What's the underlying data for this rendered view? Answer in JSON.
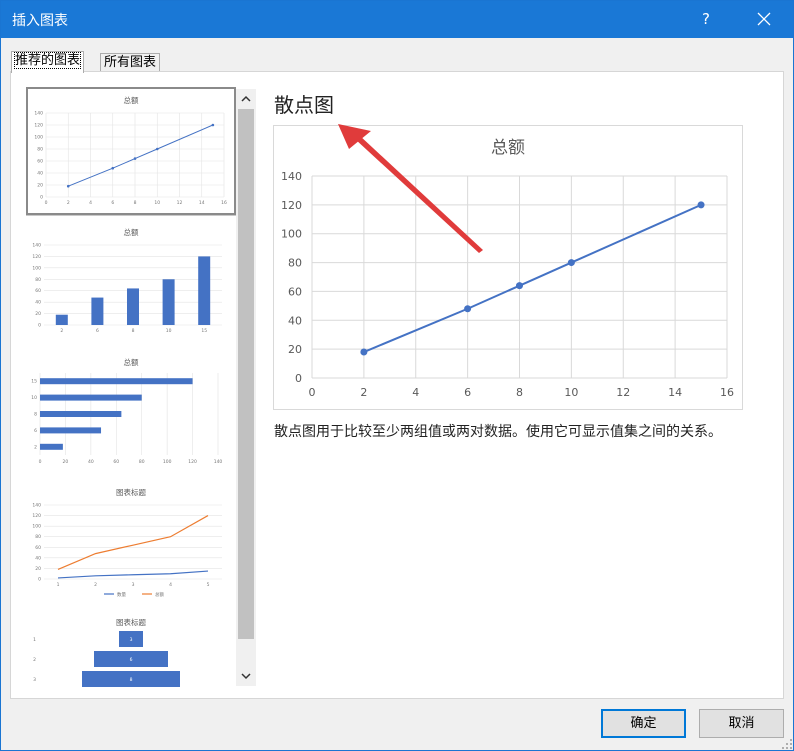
{
  "window": {
    "title": "插入图表",
    "help_label": "?"
  },
  "tabs": [
    {
      "label": "推荐的图表",
      "active": true
    },
    {
      "label": "所有图表",
      "active": false
    }
  ],
  "thumbnails": [
    {
      "title": "总额",
      "type": "scatter",
      "x_ticks": [
        "0",
        "2",
        "4",
        "6",
        "8",
        "10",
        "12",
        "14",
        "16"
      ],
      "y_ticks": [
        "0",
        "20",
        "40",
        "60",
        "80",
        "100",
        "120",
        "140"
      ]
    },
    {
      "title": "总额",
      "type": "bar",
      "x_ticks": [
        "2",
        "6",
        "8",
        "10",
        "15"
      ],
      "y_ticks": [
        "0",
        "20",
        "40",
        "60",
        "80",
        "100",
        "120",
        "140"
      ]
    },
    {
      "title": "总额",
      "type": "barh",
      "x_ticks": [
        "0",
        "20",
        "40",
        "60",
        "80",
        "100",
        "120",
        "140"
      ],
      "y_ticks": [
        "2",
        "6",
        "8",
        "10",
        "15"
      ]
    },
    {
      "title": "图表标题",
      "type": "line",
      "x_ticks": [
        "1",
        "2",
        "3",
        "4",
        "5"
      ],
      "y_ticks": [
        "0",
        "20",
        "40",
        "60",
        "80",
        "100",
        "120",
        "140"
      ],
      "legend": [
        "数量",
        "总额"
      ]
    },
    {
      "title": "图表标题",
      "type": "funnel",
      "y_ticks": [
        "1",
        "2",
        "3"
      ],
      "bar_labels": [
        "3",
        "6",
        "8"
      ]
    }
  ],
  "preview": {
    "chart_type_name": "散点图",
    "description": "散点图用于比较至少两组值或两对数据。使用它可显示值集之间的关系。"
  },
  "chart_data": {
    "type": "scatter",
    "title": "总额",
    "x": [
      2,
      6,
      8,
      10,
      15
    ],
    "y": [
      18,
      48,
      64,
      80,
      120
    ],
    "xlim": [
      0,
      16
    ],
    "ylim": [
      0,
      140
    ],
    "x_ticks": [
      0,
      2,
      4,
      6,
      8,
      10,
      12,
      14,
      16
    ],
    "y_ticks": [
      0,
      20,
      40,
      60,
      80,
      100,
      120,
      140
    ],
    "grid": true,
    "connected": true,
    "color": "#4472c4",
    "line_series": [
      {
        "name": "数量",
        "values": [
          2,
          6,
          8,
          10,
          15
        ],
        "color": "#4472c4"
      },
      {
        "name": "总额",
        "values": [
          18,
          48,
          64,
          80,
          120
        ],
        "color": "#ed7d31"
      }
    ]
  },
  "buttons": {
    "ok": "确定",
    "cancel": "取消"
  },
  "colors": {
    "titlebar": "#1a78d6",
    "accent": "#0078d7",
    "series": "#4472c4",
    "series2": "#ed7d31",
    "arrow": "#e03b3b"
  }
}
